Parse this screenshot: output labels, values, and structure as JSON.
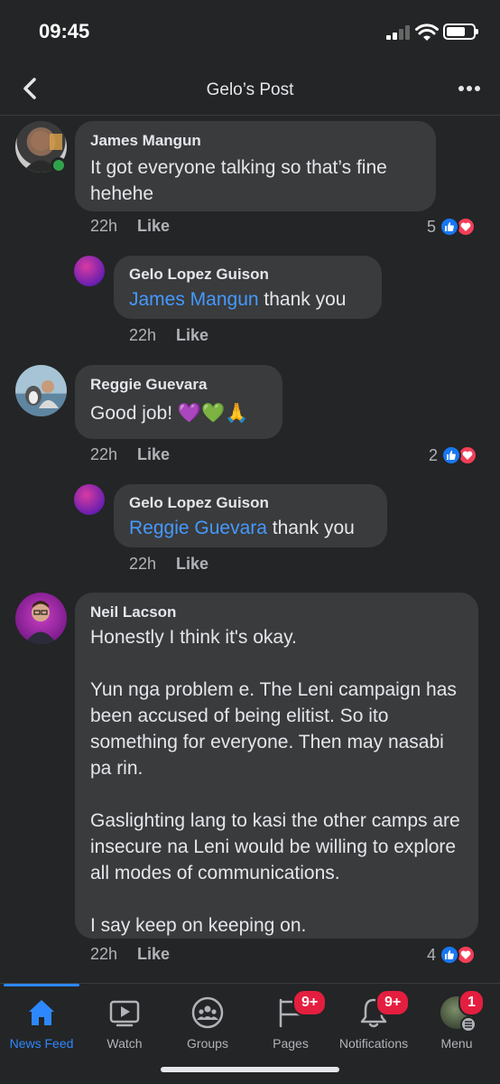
{
  "status": {
    "time": "09:45"
  },
  "header": {
    "title": "Gelo’s Post"
  },
  "comments": [
    {
      "author": "James Mangun",
      "text": "It got everyone talking so that’s fine hehehe",
      "time": "22h",
      "like": "Like",
      "reactions": "5"
    },
    {
      "author": "Gelo Lopez Guison",
      "mention": "James Mangun",
      "text": " thank you",
      "time": "22h",
      "like": "Like"
    },
    {
      "author": "Reggie Guevara",
      "text": "Good job! 💜💚🙏",
      "time": "22h",
      "like": "Like",
      "reactions": "2"
    },
    {
      "author": "Gelo Lopez Guison",
      "mention": "Reggie Guevara",
      "text": " thank you",
      "time": "22h",
      "like": "Like"
    },
    {
      "author": "Neil Lacson",
      "text": "Honestly I think it's okay.\n\nYun nga problem e. The Leni campaign has been accused of being elitist. So ito something for everyone. Then may nasabi pa rin.\n\nGaslighting lang to kasi the other camps are insecure na Leni would be willing to explore all modes of communications.\n\nI say keep on keeping on.",
      "time": "22h",
      "like": "Like",
      "reactions": "4"
    }
  ],
  "tabs": [
    {
      "label": "News Feed",
      "icon": "home-icon"
    },
    {
      "label": "Watch",
      "icon": "watch-icon"
    },
    {
      "label": "Groups",
      "icon": "groups-icon"
    },
    {
      "label": "Pages",
      "icon": "flag-icon",
      "badge": "9+"
    },
    {
      "label": "Notifications",
      "icon": "bell-icon",
      "badge": "9+"
    },
    {
      "label": "Menu",
      "icon": "menu-avatar-icon",
      "badge": "1"
    }
  ],
  "colors": {
    "background": "#242526",
    "bubble": "#3a3b3c",
    "accent": "#2d88ff",
    "mention": "#4599ff",
    "badge": "#e41e3f"
  }
}
